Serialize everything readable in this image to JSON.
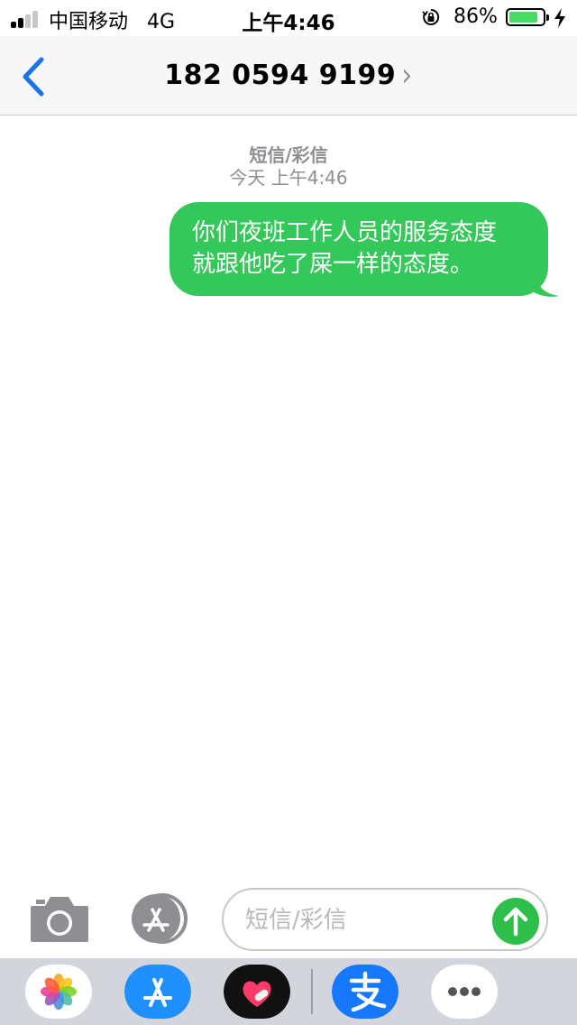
{
  "status_bar": {
    "carrier": "中国移动",
    "network": "4G",
    "time": "上午4:46",
    "battery_percent": "86%",
    "battery_level": 0.86,
    "icons": [
      "signal-icon",
      "orientation-lock-icon",
      "battery-icon",
      "charging-bolt-icon"
    ]
  },
  "header": {
    "contact": "182 0594 9199",
    "chevron": "›",
    "back_icon": "chevron-left-icon"
  },
  "thread": {
    "service_label": "短信/彩信",
    "timestamp": "今天 上午4:46",
    "messages": [
      {
        "direction": "outgoing",
        "lines": [
          "你们夜班工作人员的服务态度",
          "就跟他吃了屎一样的态度。"
        ]
      }
    ]
  },
  "compose": {
    "placeholder": "短信/彩信",
    "value": "",
    "camera_icon": "camera-icon",
    "apps_icon": "app-store-icon",
    "send_icon": "send-arrow-icon"
  },
  "app_drawer": {
    "apps": [
      "photos-icon",
      "app-store-icon",
      "heart-app-icon",
      "alipay-icon",
      "more-icon"
    ]
  },
  "colors": {
    "accent": "#1a73e8",
    "bubble": "#34c759",
    "send": "#2ebf4a",
    "drawer": "#d2d5db"
  }
}
